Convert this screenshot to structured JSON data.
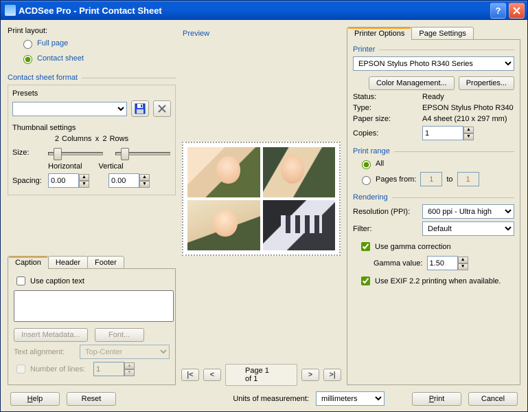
{
  "title": "ACDSee Pro - Print Contact Sheet",
  "left": {
    "print_layout_label": "Print layout:",
    "full_page": "Full page",
    "contact_sheet": "Contact sheet",
    "contact_sheet_format": "Contact sheet format",
    "presets_label": "Presets",
    "thumbnail_settings": "Thumbnail settings",
    "columns_val": "2",
    "columns_lbl": "Columns",
    "x_lbl": "x",
    "rows_val": "2",
    "rows_lbl": "Rows",
    "size_lbl": "Size:",
    "spacing_lbl": "Spacing:",
    "horizontal_lbl": "Horizontal",
    "vertical_lbl": "Vertical",
    "hspacing": "0.00",
    "vspacing": "0.00"
  },
  "caption": {
    "tabs": {
      "caption": "Caption",
      "header": "Header",
      "footer": "Footer"
    },
    "use_caption_text": "Use caption text",
    "insert_metadata": "Insert Metadata...",
    "font": "Font...",
    "text_alignment": "Text alignment:",
    "align_value": "Top-Center",
    "number_of_lines": "Number of lines:",
    "lines_value": "1"
  },
  "preview": {
    "label": "Preview",
    "page_text": "Page 1 of 1",
    "first": "|<",
    "prev": "<",
    "next": ">",
    "last": ">|"
  },
  "printer": {
    "tabs": {
      "options": "Printer Options",
      "page": "Page Settings"
    },
    "printer_lbl": "Printer",
    "printer_name": "EPSON Stylus Photo R340 Series",
    "color_mgmt": "Color Management...",
    "properties": "Properties...",
    "status_lbl": "Status:",
    "status_val": "Ready",
    "type_lbl": "Type:",
    "type_val": "EPSON Stylus Photo R340",
    "paper_lbl": "Paper size:",
    "paper_val": "A4 sheet (210 x 297 mm)",
    "copies_lbl": "Copies:",
    "copies_val": "1",
    "range_lbl": "Print range",
    "all": "All",
    "pages_from": "Pages from:",
    "from_val": "1",
    "to": "to",
    "to_val": "1",
    "rendering_lbl": "Rendering",
    "res_lbl": "Resolution (PPI):",
    "res_val": "600 ppi - Ultra high",
    "filter_lbl": "Filter:",
    "filter_val": "Default",
    "gamma_chk": "Use gamma correction",
    "gamma_lbl": "Gamma value:",
    "gamma_val": "1.50",
    "exif_chk": "Use EXIF 2.2 printing when available."
  },
  "bottom": {
    "help": "Help",
    "reset": "Reset",
    "units_lbl": "Units of measurement:",
    "units_val": "millimeters",
    "print": "Print",
    "cancel": "Cancel"
  }
}
